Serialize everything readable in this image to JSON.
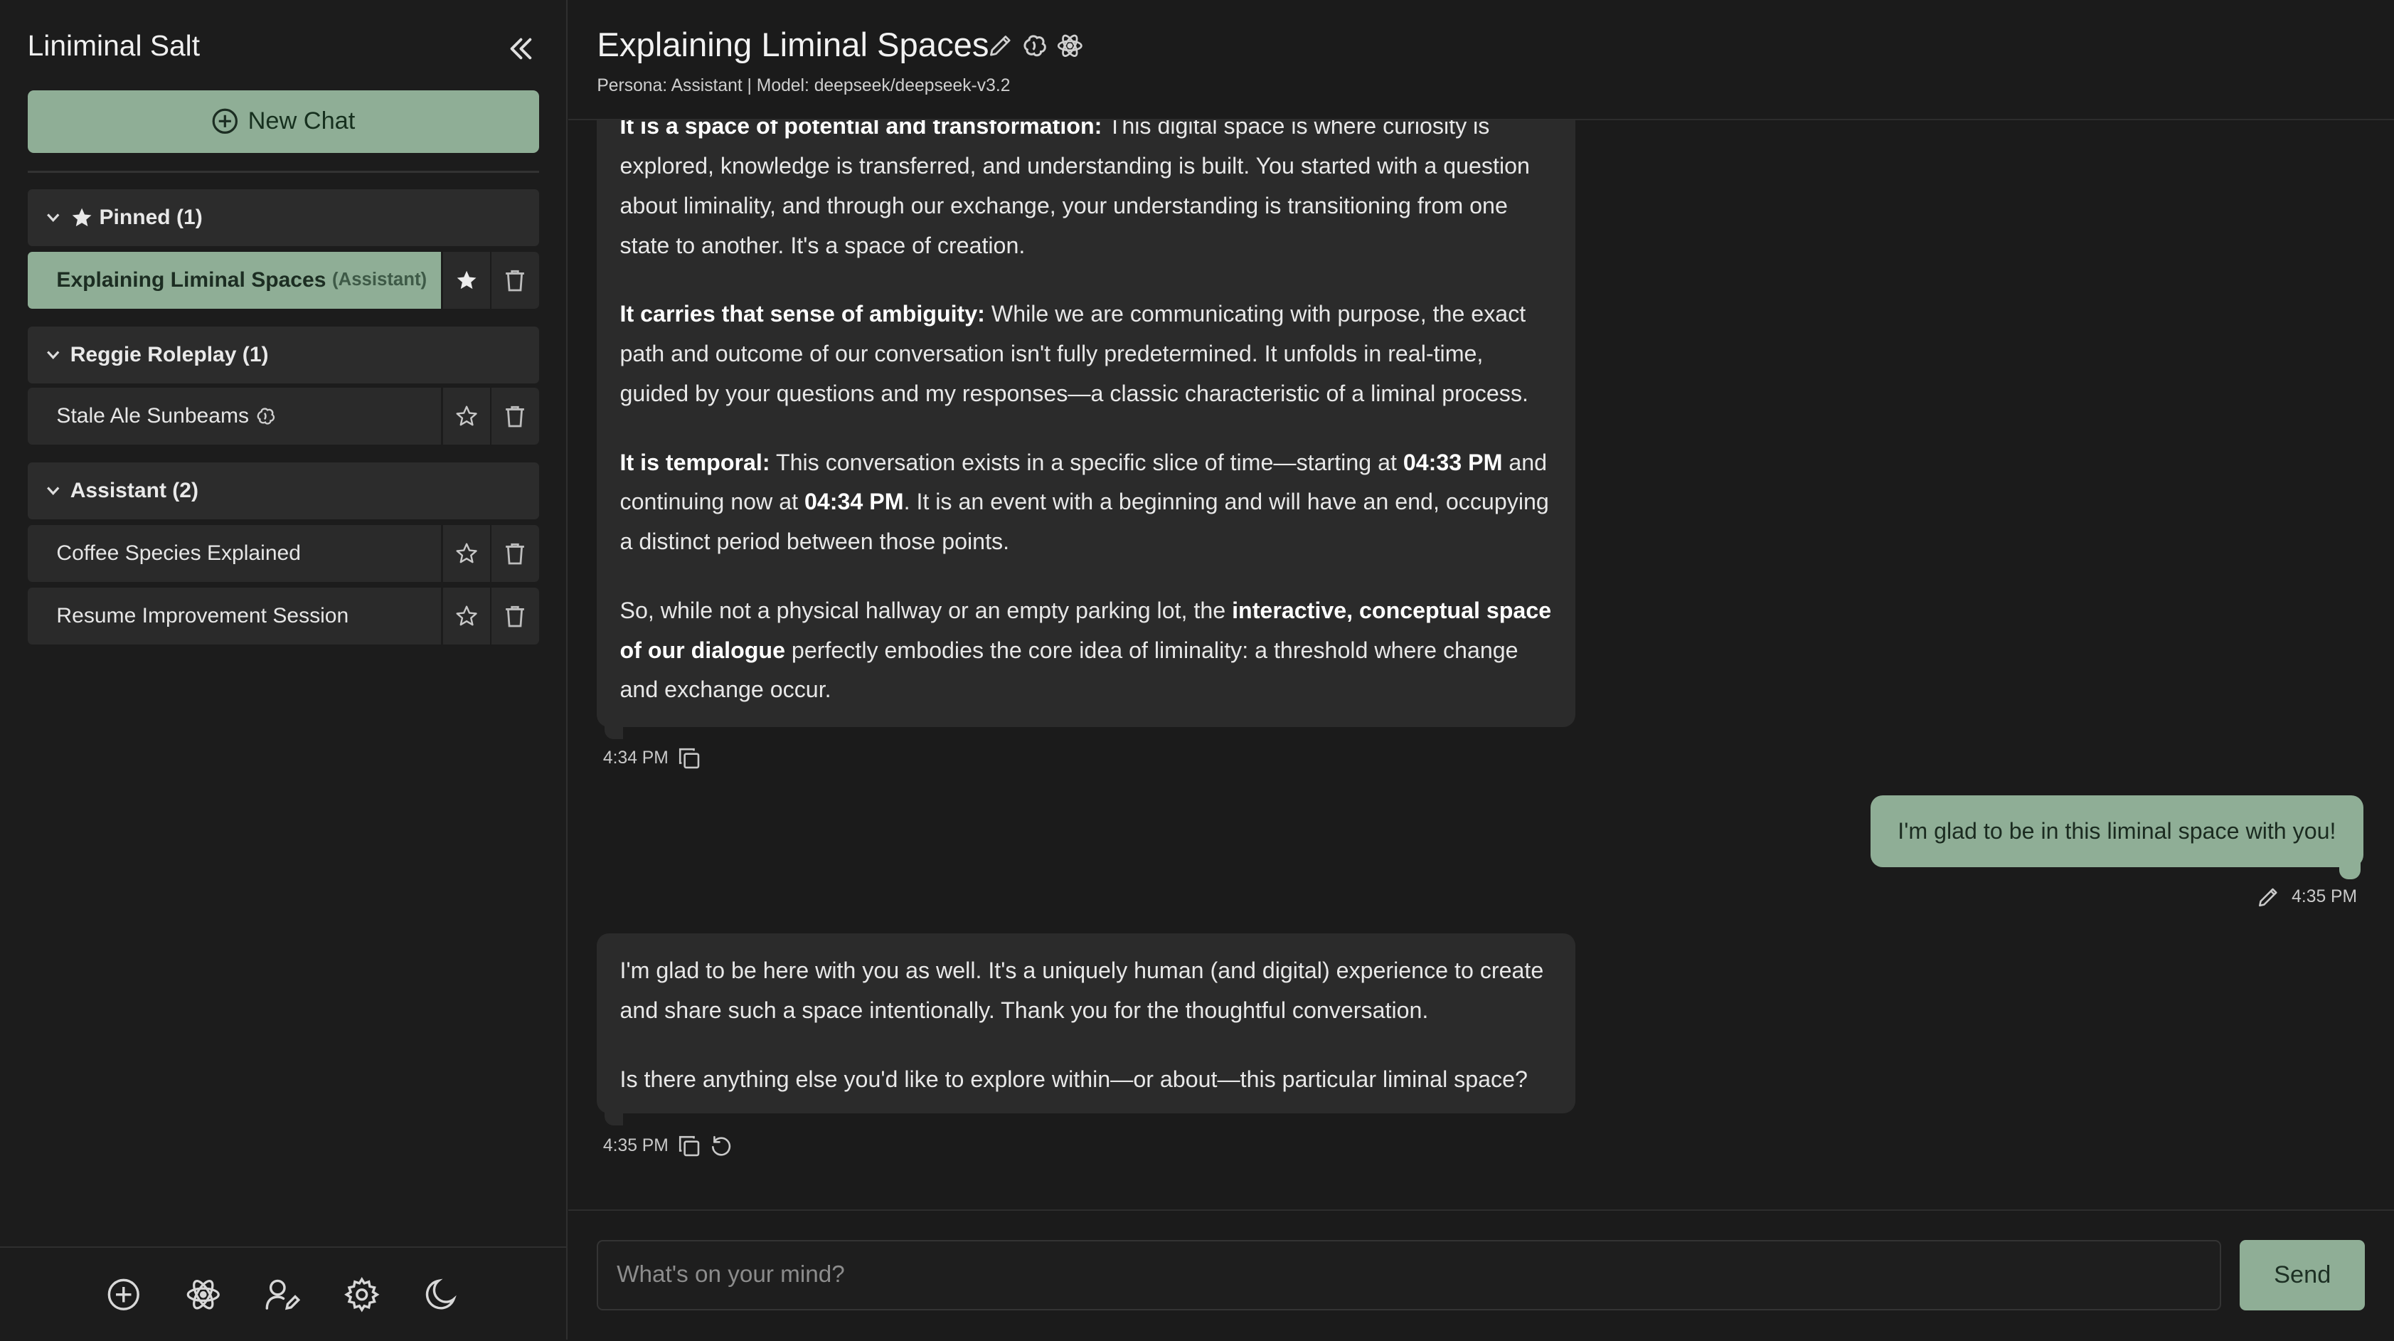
{
  "app": {
    "title": "Liniminal Salt"
  },
  "sidebar": {
    "new_chat_label": "New Chat",
    "groups": [
      {
        "label": "Pinned (1)",
        "chats": [
          {
            "title": "Explaining Liminal Spaces",
            "persona": "(Assistant)",
            "pinned": true,
            "active": true
          }
        ]
      },
      {
        "label": "Reggie Roleplay (1)",
        "chats": [
          {
            "title": "Stale Ale Sunbeams",
            "pinned": false
          }
        ]
      },
      {
        "label": "Assistant (2)",
        "chats": [
          {
            "title": "Coffee Species Explained",
            "pinned": false
          },
          {
            "title": "Resume Improvement Session",
            "pinned": false
          }
        ]
      }
    ],
    "footer_icons": [
      "new-chat-icon",
      "atom-icon",
      "user-edit-icon",
      "settings-icon",
      "moon-icon"
    ]
  },
  "header": {
    "title": "Explaining Liminal Spaces",
    "subtitle": "Persona: Assistant | Model: deepseek/deepseek-v3.2"
  },
  "messages": [
    {
      "role": "assistant",
      "time": "4:34 PM",
      "paragraphs": [
        {
          "bold": "It is a space of potential and transformation:",
          "text": " This digital space is where curiosity is explored, knowledge is transferred, and understanding is built. You started with a question about liminality, and through our exchange, your understanding is transitioning from one state to another. It's a space of creation."
        },
        {
          "bold": "It carries that sense of ambiguity:",
          "text": " While we are communicating with purpose, the exact path and outcome of our conversation isn't fully predetermined. It unfolds in real-time, guided by your questions and my responses—a classic characteristic of a liminal process."
        },
        {
          "bold": "It is temporal:",
          "text1": " This conversation exists in a specific slice of time—starting at ",
          "bold2": "04:33 PM",
          "text2": " and continuing now at ",
          "bold3": "04:34 PM",
          "text3": ". It is an event with a beginning and will have an end, occupying a distinct period between those points."
        },
        {
          "text1": "So, while not a physical hallway or an empty parking lot, the ",
          "bold": "interactive, conceptual space of our dialogue",
          "text2": " perfectly embodies the core idea of liminality: a threshold where change and exchange occur."
        }
      ]
    },
    {
      "role": "user",
      "text": "I'm glad to be in this liminal space with you!",
      "time": "4:35 PM"
    },
    {
      "role": "assistant",
      "time": "4:35 PM",
      "paragraphs": [
        {
          "text": "I'm glad to be here with you as well. It's a uniquely human (and digital) experience to create and share such a space intentionally. Thank you for the thoughtful conversation."
        },
        {
          "text": "Is there anything else you'd like to explore within—or about—this particular liminal space?"
        }
      ]
    }
  ],
  "composer": {
    "placeholder": "What's on your mind?",
    "send_label": "Send"
  }
}
